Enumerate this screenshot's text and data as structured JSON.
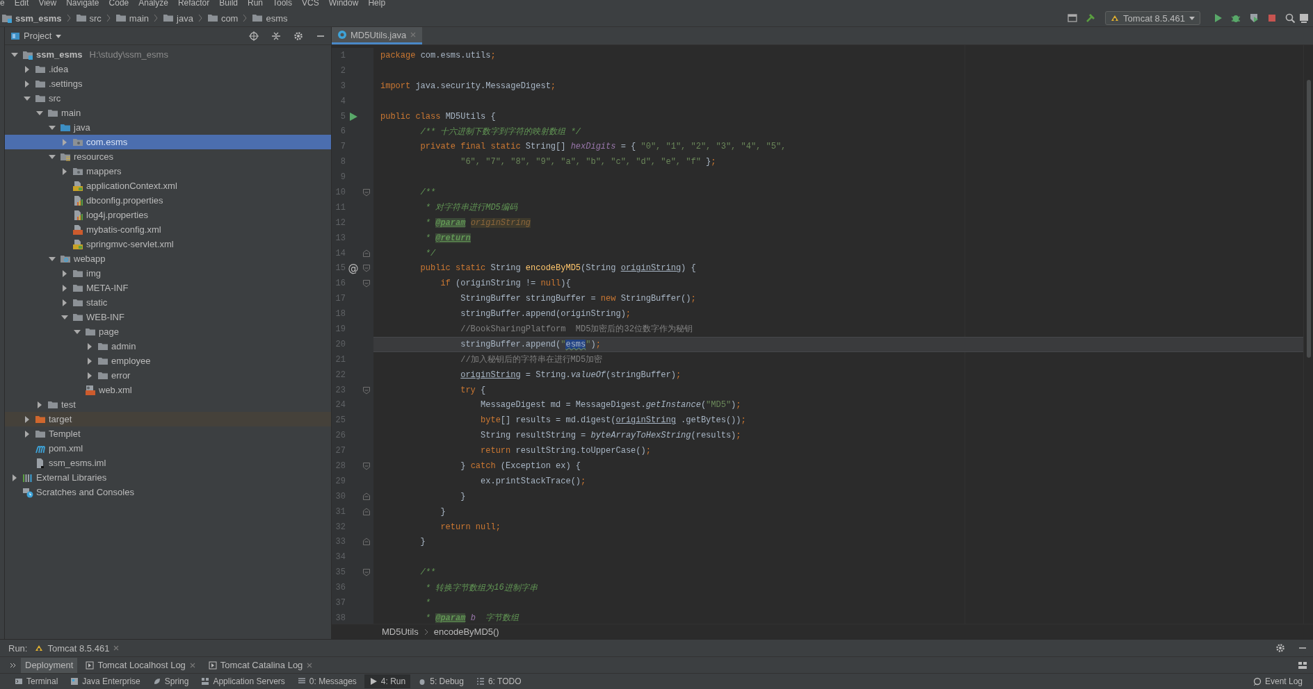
{
  "menu": [
    "e",
    "Edit",
    "View",
    "Navigate",
    "Code",
    "Analyze",
    "Refactor",
    "Build",
    "Run",
    "Tools",
    "VCS",
    "Window",
    "Help"
  ],
  "navigation": {
    "project": "ssm_esms",
    "crumbs": [
      "src",
      "main",
      "java",
      "com",
      "esms"
    ],
    "run_config": "Tomcat 8.5.461"
  },
  "project_panel": {
    "title": "Project",
    "tree": [
      {
        "label": "ssm_esms",
        "hint": "H:\\study\\ssm_esms",
        "kind": "module",
        "expanded": true,
        "selected": false,
        "children": [
          {
            "label": ".idea",
            "kind": "folder",
            "expanded": false,
            "selected": false
          },
          {
            "label": ".settings",
            "kind": "folder",
            "expanded": false,
            "selected": false
          },
          {
            "label": "src",
            "kind": "folder",
            "expanded": true,
            "selected": false,
            "children": [
              {
                "label": "main",
                "kind": "folder",
                "expanded": true,
                "selected": false,
                "children": [
                  {
                    "label": "java",
                    "kind": "source",
                    "expanded": true,
                    "selected": false,
                    "children": [
                      {
                        "label": "com.esms",
                        "kind": "package",
                        "expanded": false,
                        "selected": true
                      }
                    ]
                  },
                  {
                    "label": "resources",
                    "kind": "resources",
                    "expanded": true,
                    "selected": false,
                    "children": [
                      {
                        "label": "mappers",
                        "kind": "package",
                        "expanded": false,
                        "selected": false
                      },
                      {
                        "label": "applicationContext.xml",
                        "kind": "spring-xml",
                        "selected": false
                      },
                      {
                        "label": "dbconfig.properties",
                        "kind": "properties",
                        "selected": false
                      },
                      {
                        "label": "log4j.properties",
                        "kind": "properties",
                        "selected": false
                      },
                      {
                        "label": "mybatis-config.xml",
                        "kind": "xml",
                        "selected": false
                      },
                      {
                        "label": "springmvc-servlet.xml",
                        "kind": "spring-xml",
                        "selected": false
                      }
                    ]
                  },
                  {
                    "label": "webapp",
                    "kind": "web",
                    "expanded": true,
                    "selected": false,
                    "children": [
                      {
                        "label": "img",
                        "kind": "folder",
                        "expanded": false,
                        "selected": false
                      },
                      {
                        "label": "META-INF",
                        "kind": "folder",
                        "expanded": false,
                        "selected": false
                      },
                      {
                        "label": "static",
                        "kind": "folder",
                        "expanded": false,
                        "selected": false
                      },
                      {
                        "label": "WEB-INF",
                        "kind": "folder",
                        "expanded": true,
                        "selected": false,
                        "children": [
                          {
                            "label": "page",
                            "kind": "folder",
                            "expanded": true,
                            "selected": false,
                            "children": [
                              {
                                "label": "admin",
                                "kind": "folder",
                                "expanded": false,
                                "selected": false
                              },
                              {
                                "label": "employee",
                                "kind": "folder",
                                "expanded": false,
                                "selected": false
                              },
                              {
                                "label": "error",
                                "kind": "folder",
                                "expanded": false,
                                "selected": false
                              }
                            ]
                          },
                          {
                            "label": "web.xml",
                            "kind": "web-xml",
                            "selected": false
                          }
                        ]
                      }
                    ]
                  }
                ]
              },
              {
                "label": "test",
                "kind": "folder",
                "expanded": false,
                "selected": false
              }
            ]
          },
          {
            "label": "target",
            "kind": "excluded",
            "expanded": false,
            "selected": false
          },
          {
            "label": "Templet",
            "kind": "folder",
            "expanded": false,
            "selected": false
          },
          {
            "label": "pom.xml",
            "kind": "maven",
            "selected": false
          },
          {
            "label": "ssm_esms.iml",
            "kind": "iml",
            "selected": false
          }
        ]
      },
      {
        "label": "External Libraries",
        "kind": "libraries",
        "expanded": false,
        "selected": false
      },
      {
        "label": "Scratches and Consoles",
        "kind": "scratches",
        "selected": false
      }
    ]
  },
  "editor": {
    "tab": {
      "label": "MD5Utils.java",
      "selected": true
    },
    "lines": [
      {
        "n": "1",
        "tokens": [
          {
            "text": "package",
            "kind": "kw"
          },
          {
            "text": " com.esms.utils",
            "kind": "p"
          },
          {
            "text": ";",
            "kind": "kw"
          }
        ]
      },
      {
        "n": "2"
      },
      {
        "n": "3",
        "tokens": [
          {
            "text": "import",
            "kind": "kw"
          },
          {
            "text": " java.security.MessageDigest",
            "kind": "p"
          },
          {
            "text": ";",
            "kind": "kw"
          }
        ]
      },
      {
        "n": "4"
      },
      {
        "n": "5",
        "run": true,
        "tokens": [
          {
            "text": "public class",
            "kind": "kw"
          },
          {
            "text": " MD5Utils {",
            "kind": "p"
          }
        ]
      },
      {
        "n": "6",
        "tokens": [
          {
            "text": "        /** 十六进制下数字到字符的映射数组 */",
            "kind": "doc"
          }
        ]
      },
      {
        "n": "7",
        "tokens": [
          {
            "text": "        private final static",
            "kind": "kw"
          },
          {
            "text": " String[] ",
            "kind": "p"
          },
          {
            "text": "hexDigits",
            "kind": "field"
          },
          {
            "text": " = { ",
            "kind": "p"
          },
          {
            "text": "\"0\", \"1\", \"2\", \"3\", \"4\", \"5\",",
            "kind": "str"
          }
        ]
      },
      {
        "n": "8",
        "tokens": [
          {
            "text": "                \"6\", \"7\", \"8\", \"9\", \"a\", \"b\", \"c\", \"d\", \"e\", \"f\"",
            "kind": "str"
          },
          {
            "text": " }",
            "kind": "p"
          },
          {
            "text": ";",
            "kind": "kw"
          }
        ]
      },
      {
        "n": "9"
      },
      {
        "n": "10",
        "fold_start": true,
        "tokens": [
          {
            "text": "        /**",
            "kind": "doc"
          }
        ]
      },
      {
        "n": "11",
        "tokens": [
          {
            "text": "         * 对字符串进行",
            "kind": "doc"
          },
          {
            "text": "MD5",
            "kind": "doci"
          },
          {
            "text": "编码",
            "kind": "doc"
          }
        ]
      },
      {
        "n": "12",
        "tokens": [
          {
            "text": "         * ",
            "kind": "doc"
          },
          {
            "text": "@param",
            "kind": "tag"
          },
          {
            "text": " originString",
            "kind": "dparam"
          }
        ]
      },
      {
        "n": "13",
        "tokens": [
          {
            "text": "         * ",
            "kind": "doc"
          },
          {
            "text": "@return",
            "kind": "tag"
          }
        ]
      },
      {
        "n": "14",
        "fold_end": true,
        "tokens": [
          {
            "text": "         */",
            "kind": "doc"
          }
        ]
      },
      {
        "n": "15",
        "mark": "@",
        "fold_start": true,
        "tokens": [
          {
            "text": "        public static",
            "kind": "kw"
          },
          {
            "text": " String ",
            "kind": "p"
          },
          {
            "text": "encodeByMD5",
            "kind": "meth"
          },
          {
            "text": "(String ",
            "kind": "p"
          },
          {
            "text": "originString",
            "kind": "ul"
          },
          {
            "text": ") {",
            "kind": "p"
          }
        ]
      },
      {
        "n": "16",
        "fold_start": true,
        "tokens": [
          {
            "text": "            if",
            "kind": "kw"
          },
          {
            "text": " (originString != ",
            "kind": "p"
          },
          {
            "text": "null",
            "kind": "kw"
          },
          {
            "text": "){",
            "kind": "p"
          }
        ]
      },
      {
        "n": "17",
        "tokens": [
          {
            "text": "                StringBuffer stringBuffer = ",
            "kind": "p"
          },
          {
            "text": "new",
            "kind": "kw"
          },
          {
            "text": " StringBuffer()",
            "kind": "p"
          },
          {
            "text": ";",
            "kind": "kw"
          }
        ]
      },
      {
        "n": "18",
        "tokens": [
          {
            "text": "                stringBuffer.append(originString)",
            "kind": "p"
          },
          {
            "text": ";",
            "kind": "kw"
          }
        ]
      },
      {
        "n": "19",
        "tokens": [
          {
            "text": "                //BookSharingPlatform  MD5加密后的32位数字作为秘钥",
            "kind": "cmt"
          }
        ]
      },
      {
        "n": "20",
        "current": true,
        "tokens": [
          {
            "text": "                stringBuffer.append(",
            "kind": "p"
          },
          {
            "text": "\"",
            "kind": "str"
          },
          {
            "text": "esms",
            "kind": "hl"
          },
          {
            "text": "\"",
            "kind": "str"
          },
          {
            "text": ")",
            "kind": "p"
          },
          {
            "text": ";",
            "kind": "kw"
          }
        ]
      },
      {
        "n": "21",
        "tokens": [
          {
            "text": "                //加入秘钥后的字符串在进行MD5加密",
            "kind": "cmt"
          }
        ]
      },
      {
        "n": "22",
        "tokens": [
          {
            "text": "                originString",
            "kind": "ul"
          },
          {
            "text": " = String.",
            "kind": "p"
          },
          {
            "text": "valueOf",
            "kind": "ital"
          },
          {
            "text": "(stringBuffer)",
            "kind": "p"
          },
          {
            "text": ";",
            "kind": "kw"
          }
        ]
      },
      {
        "n": "23",
        "fold_start": true,
        "tokens": [
          {
            "text": "                try",
            "kind": "kw"
          },
          {
            "text": " {",
            "kind": "p"
          }
        ]
      },
      {
        "n": "24",
        "tokens": [
          {
            "text": "                    MessageDigest md = MessageDigest.",
            "kind": "p"
          },
          {
            "text": "getInstance",
            "kind": "ital"
          },
          {
            "text": "(",
            "kind": "p"
          },
          {
            "text": "\"MD5\"",
            "kind": "str"
          },
          {
            "text": ")",
            "kind": "p"
          },
          {
            "text": ";",
            "kind": "kw"
          }
        ]
      },
      {
        "n": "25",
        "tokens": [
          {
            "text": "                    byte",
            "kind": "kw"
          },
          {
            "text": "[] results = md.digest(",
            "kind": "p"
          },
          {
            "text": "originString",
            "kind": "ul"
          },
          {
            "text": " .getBytes())",
            "kind": "p"
          },
          {
            "text": ";",
            "kind": "kw"
          }
        ]
      },
      {
        "n": "26",
        "tokens": [
          {
            "text": "                    String resultString = ",
            "kind": "p"
          },
          {
            "text": "byteArrayToHexString",
            "kind": "ital"
          },
          {
            "text": "(results)",
            "kind": "p"
          },
          {
            "text": ";",
            "kind": "kw"
          }
        ]
      },
      {
        "n": "27",
        "tokens": [
          {
            "text": "                    return",
            "kind": "kw"
          },
          {
            "text": " resultString.toUpperCase()",
            "kind": "p"
          },
          {
            "text": ";",
            "kind": "kw"
          }
        ]
      },
      {
        "n": "28",
        "fold_start": true,
        "tokens": [
          {
            "text": "                } ",
            "kind": "p"
          },
          {
            "text": "catch",
            "kind": "kw"
          },
          {
            "text": " (Exception ex) {",
            "kind": "p"
          }
        ]
      },
      {
        "n": "29",
        "tokens": [
          {
            "text": "                    ex.printStackTrace()",
            "kind": "p"
          },
          {
            "text": ";",
            "kind": "kw"
          }
        ]
      },
      {
        "n": "30",
        "fold_end": true,
        "tokens": [
          {
            "text": "                }",
            "kind": "p"
          }
        ]
      },
      {
        "n": "31",
        "fold_end": true,
        "tokens": [
          {
            "text": "            }",
            "kind": "p"
          }
        ]
      },
      {
        "n": "32",
        "tokens": [
          {
            "text": "            return null",
            "kind": "kw"
          },
          {
            "text": ";",
            "kind": "kw"
          }
        ]
      },
      {
        "n": "33",
        "fold_end": true,
        "tokens": [
          {
            "text": "        }",
            "kind": "p"
          }
        ]
      },
      {
        "n": "34"
      },
      {
        "n": "35",
        "fold_start": true,
        "tokens": [
          {
            "text": "        /**",
            "kind": "doc"
          }
        ]
      },
      {
        "n": "36",
        "tokens": [
          {
            "text": "         * 转换字节数组为",
            "kind": "doc"
          },
          {
            "text": "16",
            "kind": "doci"
          },
          {
            "text": "进制字串",
            "kind": "doc"
          }
        ]
      },
      {
        "n": "37",
        "tokens": [
          {
            "text": "         *",
            "kind": "doc"
          }
        ]
      },
      {
        "n": "38",
        "tokens": [
          {
            "text": "         * ",
            "kind": "doc"
          },
          {
            "text": "@param",
            "kind": "tag"
          },
          {
            "text": " b",
            "kind": "field"
          },
          {
            "text": "  字节数组",
            "kind": "doc"
          }
        ]
      }
    ],
    "breadcrumb": [
      "MD5Utils",
      "encodeByMD5()"
    ]
  },
  "run_panel": {
    "label": "Run:",
    "session": "Tomcat 8.5.461",
    "tabs": [
      {
        "label": "Deployment",
        "selected": true,
        "closable": false
      },
      {
        "label": "Tomcat Localhost Log",
        "selected": false,
        "closable": true
      },
      {
        "label": "Tomcat Catalina Log",
        "selected": false,
        "closable": true
      }
    ]
  },
  "tool_strip": {
    "items": [
      {
        "label": "Terminal",
        "selected": false
      },
      {
        "label": "Java Enterprise",
        "selected": false
      },
      {
        "label": "Spring",
        "selected": false
      },
      {
        "label": "Application Servers",
        "selected": false
      },
      {
        "label": "0: Messages",
        "selected": false
      },
      {
        "label": "4: Run",
        "selected": true
      },
      {
        "label": "5: Debug",
        "selected": false
      },
      {
        "label": "6: TODO",
        "selected": false
      }
    ],
    "right": "Event Log"
  }
}
